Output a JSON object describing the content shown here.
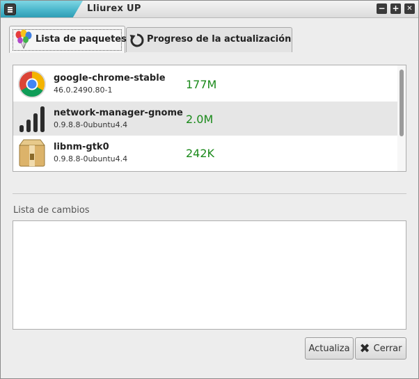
{
  "window": {
    "title": "Lliurex UP",
    "controls": {
      "minimize": "−",
      "maximize": "+",
      "close": "✕"
    }
  },
  "tabs": [
    {
      "label": "Lista de paquetes",
      "icon": "balloons-icon",
      "active": true
    },
    {
      "label": "Progreso de la actualización",
      "icon": "refresh-icon",
      "active": false
    }
  ],
  "packages": [
    {
      "name": "google-chrome-stable",
      "version": "46.0.2490.80-1",
      "size": "177M",
      "icon": "chrome-icon",
      "selected": false
    },
    {
      "name": "network-manager-gnome",
      "version": "0.9.8.8-0ubuntu4.4",
      "size": "2.0M",
      "icon": "signal-bars-icon",
      "selected": true
    },
    {
      "name": "libnm-gtk0",
      "version": "0.9.8.8-0ubuntu4.4",
      "size": "242K",
      "icon": "package-box-icon",
      "selected": false
    }
  ],
  "changes": {
    "label": "Lista de cambios",
    "content": ""
  },
  "buttons": {
    "update": "Actualiza",
    "close": "Cerrar"
  },
  "colors": {
    "size_text": "#1b8a1b",
    "title_accent": "#4bb7cc",
    "selected_row": "#e6e6e6"
  }
}
